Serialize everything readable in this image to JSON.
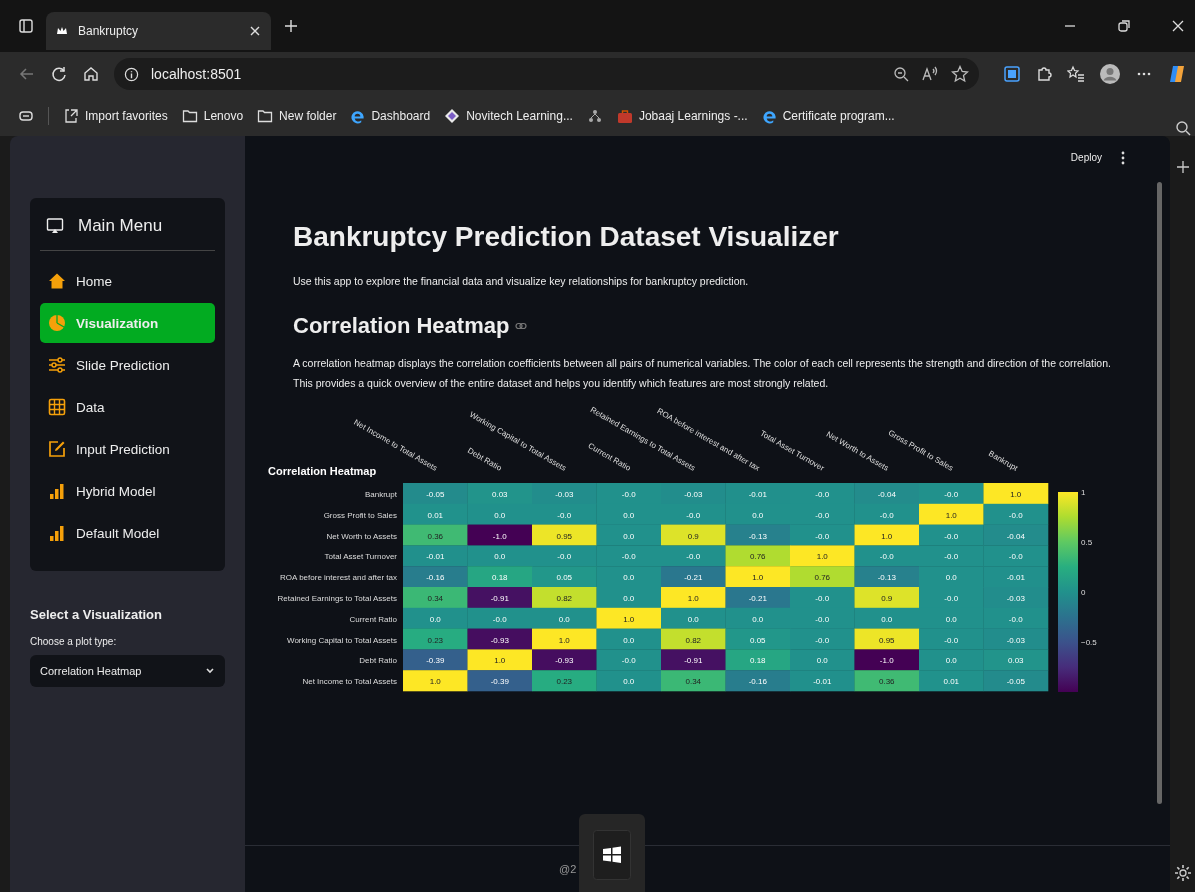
{
  "browser": {
    "tab_title": "Bankruptcy",
    "url": "localhost:8501",
    "bookmarks": [
      {
        "kind": "import",
        "label": "Import favorites"
      },
      {
        "kind": "folder",
        "label": "Lenovo"
      },
      {
        "kind": "folder",
        "label": "New folder"
      },
      {
        "kind": "edge",
        "label": "Dashboard"
      },
      {
        "kind": "logo",
        "label": "Novitech Learning..."
      },
      {
        "kind": "network"
      },
      {
        "kind": "briefcase",
        "label": "Jobaaj Learnings -..."
      },
      {
        "kind": "edge",
        "label": "Certificate program..."
      }
    ]
  },
  "header": {
    "deploy": "Deploy"
  },
  "sidebar": {
    "menu_title": "Main Menu",
    "items": [
      {
        "kind": "home",
        "label": "Home",
        "selected": false
      },
      {
        "kind": "pie",
        "label": "Visualization",
        "selected": true
      },
      {
        "kind": "sliders",
        "label": "Slide Prediction",
        "selected": false
      },
      {
        "kind": "table",
        "label": "Data",
        "selected": false
      },
      {
        "kind": "edit",
        "label": "Input Prediction",
        "selected": false
      },
      {
        "kind": "bars",
        "label": "Hybrid Model",
        "selected": false
      },
      {
        "kind": "bars",
        "label": "Default Model",
        "selected": false
      }
    ],
    "section_title": "Select a Visualization",
    "select_label": "Choose a plot type:",
    "select_value": "Correlation Heatmap"
  },
  "main": {
    "title": "Bankruptcy Prediction Dataset Visualizer",
    "intro": "Use this app to explore the financial data and visualize key relationships for bankruptcy prediction.",
    "section_title": "Correlation Heatmap",
    "description": "A correlation heatmap displays the correlation coefficients between all pairs of numerical variables. The color of each cell represents the strength and direction of the correlation. This provides a quick overview of the entire dataset and helps you identify which features are most strongly related.",
    "heatmap": {
      "title": "Correlation Heatmap",
      "columns": [
        "Net Income to Total Assets",
        "Debt Ratio",
        "Working Capital to Total Assets",
        "Current Ratio",
        "Retained Earnings to Total Assets",
        "ROA before interest and after tax",
        "Total Asset Turnover",
        "Net Worth to Assets",
        "Gross Profit to Sales",
        "Bankrupt"
      ],
      "rows": [
        {
          "label": "Bankrupt",
          "cells": [
            "-0.05",
            "0.03",
            "-0.03",
            "-0.0",
            "-0.03",
            "-0.01",
            "-0.0",
            "-0.04",
            "-0.0",
            "1.0"
          ]
        },
        {
          "label": "Gross Profit to Sales",
          "cells": [
            "0.01",
            "0.0",
            "-0.0",
            "0.0",
            "-0.0",
            "0.0",
            "-0.0",
            "-0.0",
            "1.0",
            "-0.0"
          ]
        },
        {
          "label": "Net Worth to Assets",
          "cells": [
            "0.36",
            "-1.0",
            "0.95",
            "0.0",
            "0.9",
            "-0.13",
            "-0.0",
            "1.0",
            "-0.0",
            "-0.04"
          ]
        },
        {
          "label": "Total Asset Turnover",
          "cells": [
            "-0.01",
            "0.0",
            "-0.0",
            "-0.0",
            "-0.0",
            "0.76",
            "1.0",
            "-0.0",
            "-0.0",
            "-0.0"
          ]
        },
        {
          "label": "ROA before interest and after tax",
          "cells": [
            "-0.16",
            "0.18",
            "0.05",
            "0.0",
            "-0.21",
            "1.0",
            "0.76",
            "-0.13",
            "0.0",
            "-0.01"
          ]
        },
        {
          "label": "Retained Earnings to Total Assets",
          "cells": [
            "0.34",
            "-0.91",
            "0.82",
            "0.0",
            "1.0",
            "-0.21",
            "-0.0",
            "0.9",
            "-0.0",
            "-0.03"
          ]
        },
        {
          "label": "Current Ratio",
          "cells": [
            "0.0",
            "-0.0",
            "0.0",
            "1.0",
            "0.0",
            "0.0",
            "-0.0",
            "0.0",
            "0.0",
            "-0.0"
          ]
        },
        {
          "label": "Working Capital to Total Assets",
          "cells": [
            "0.23",
            "-0.93",
            "1.0",
            "0.0",
            "0.82",
            "0.05",
            "-0.0",
            "0.95",
            "-0.0",
            "-0.03"
          ]
        },
        {
          "label": "Debt Ratio",
          "cells": [
            "-0.39",
            "1.0",
            "-0.93",
            "-0.0",
            "-0.91",
            "0.18",
            "0.0",
            "-1.0",
            "0.0",
            "0.03"
          ]
        },
        {
          "label": "Net Income to Total Assets",
          "cells": [
            "1.0",
            "-0.39",
            "0.23",
            "0.0",
            "0.34",
            "-0.16",
            "-0.01",
            "0.36",
            "0.01",
            "-0.05"
          ]
        }
      ],
      "colorbar_ticks": [
        "1",
        "0.5",
        "0",
        "−0.5"
      ]
    }
  },
  "footer": {
    "text": "@2"
  }
}
